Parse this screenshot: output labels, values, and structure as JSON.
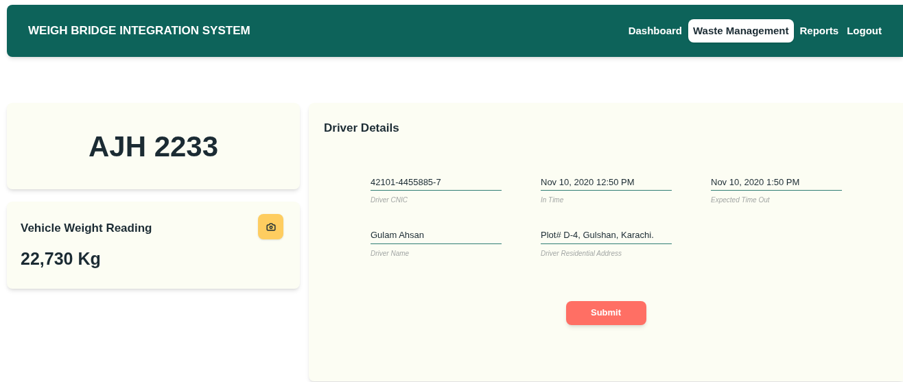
{
  "header": {
    "title": "WEIGH BRIDGE INTEGRATION SYSTEM",
    "nav": [
      {
        "label": "Dashboard",
        "selected": false
      },
      {
        "label": "Waste Management",
        "selected": true
      },
      {
        "label": "Reports",
        "selected": false
      },
      {
        "label": "Logout",
        "selected": false
      }
    ]
  },
  "plate": {
    "number": "AJH 2233"
  },
  "weight": {
    "title": "Vehicle Weight Reading",
    "value": "22,730 Kg"
  },
  "driver": {
    "title": "Driver Details",
    "fields": [
      {
        "value": "42101-4455885-7",
        "label": "Driver CNIC"
      },
      {
        "value": "Nov 10, 2020 12:50 PM",
        "label": "In Time"
      },
      {
        "value": "Nov 10, 2020 1:50 PM",
        "label": "Expected Time Out"
      },
      {
        "value": "Gulam Ahsan",
        "label": "Driver Name"
      },
      {
        "value": "Plot# D-4, Gulshan, Karachi.",
        "label": "Driver Residential Address"
      }
    ],
    "submit": "Submit"
  }
}
